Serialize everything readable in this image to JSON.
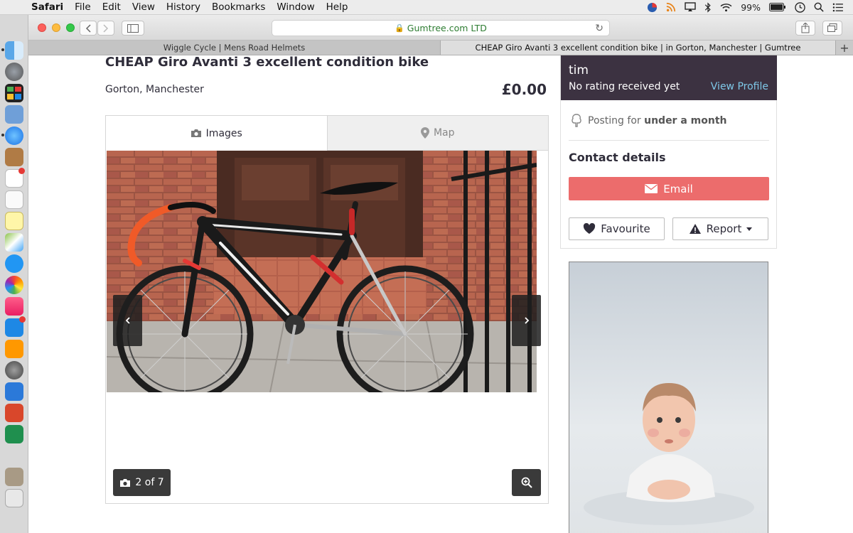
{
  "menubar": {
    "app_name": "Safari",
    "items": [
      "File",
      "Edit",
      "View",
      "History",
      "Bookmarks",
      "Window",
      "Help"
    ],
    "battery": "99%"
  },
  "browser": {
    "address": "Gumtree.com LTD",
    "tabs": [
      {
        "label": "Wiggle Cycle | Mens Road Helmets"
      },
      {
        "label": "CHEAP Giro Avanti 3 excellent condition bike | in Gorton, Manchester | Gumtree"
      }
    ]
  },
  "listing": {
    "title": "CHEAP Giro Avanti 3 excellent condition bike",
    "location": "Gorton, Manchester",
    "price": "£0.00",
    "gallery_tabs": {
      "images": "Images",
      "map": "Map"
    },
    "counter": "2 of 7"
  },
  "seller": {
    "name": "tim",
    "rating": "No rating received yet",
    "view_profile": "View Profile",
    "posting_prefix": "Posting for",
    "posting_duration": "under a month"
  },
  "contact": {
    "heading": "Contact details",
    "email_label": "Email",
    "favourite_label": "Favourite",
    "report_label": "Report"
  },
  "colors": {
    "seller_bg": "#3c3241",
    "email_button": "#ec6c6c",
    "link": "#7ec8e8"
  }
}
